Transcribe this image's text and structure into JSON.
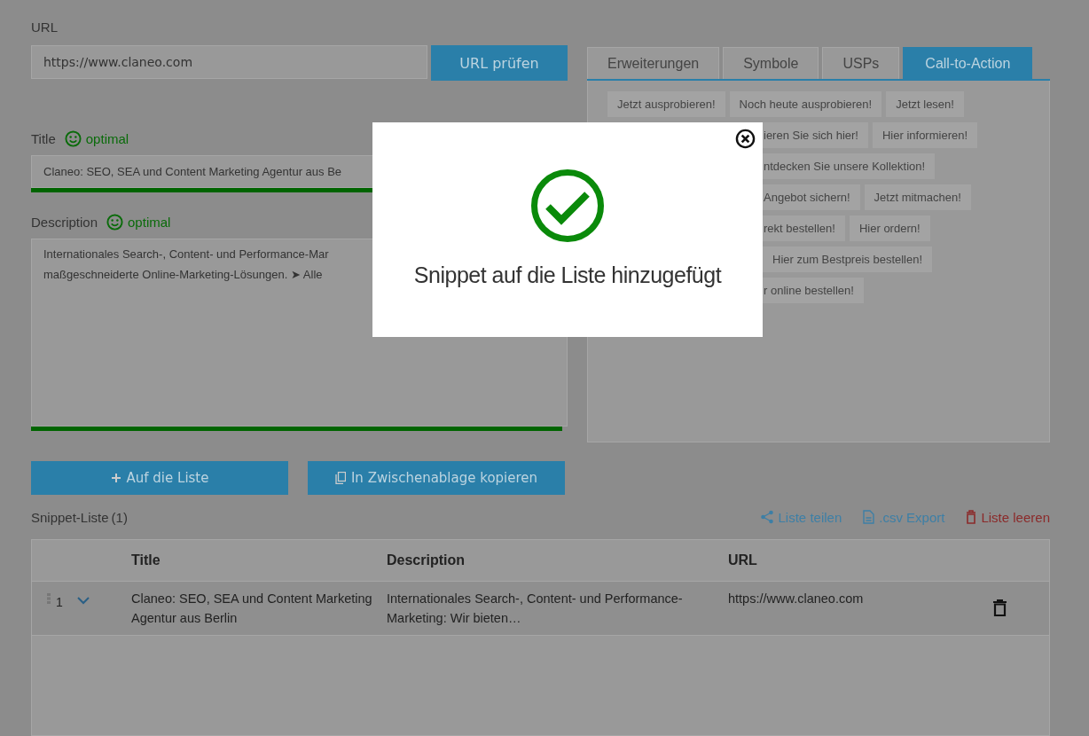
{
  "url": {
    "label": "URL",
    "value": "https://www.claneo.com",
    "button": "URL prüfen"
  },
  "fields": [
    {
      "kind": "input",
      "label": "Title",
      "status": "optimal",
      "lines": [
        "Claneo: SEO, SEA und Content Marketing Agentur aus Be"
      ],
      "level": 1
    },
    {
      "kind": "textarea",
      "label": "Description",
      "status": "optimal",
      "lines": [
        "Internationales Search-, Content- und Performance-Mar",
        "maßgeschneiderte Online-Marketing-Lösungen. ➤ Alle"
      ],
      "level": 1
    }
  ],
  "tabs": [
    {
      "label": "Erweiterungen",
      "selected": false
    },
    {
      "label": "Symbole",
      "selected": false
    },
    {
      "label": "USPs",
      "selected": false
    },
    {
      "label": "Call-to-Action",
      "selected": true
    }
  ],
  "chip_rows": [
    {
      "chips": [
        {
          "label": "Jetzt ausprobieren!",
          "cut": false
        },
        {
          "label": "Noch heute ausprobieren!",
          "cut": false
        },
        {
          "label": "Jetzt lesen!",
          "cut": false
        }
      ]
    },
    {
      "chips": [
        {
          "label": "ieren Sie sich hier!",
          "cut": true
        },
        {
          "label": "Hier informieren!",
          "cut": false
        }
      ]
    },
    {
      "chips": [
        {
          "label": "ntdecken Sie unsere Kollektion!",
          "cut": true
        }
      ]
    },
    {
      "chips": [
        {
          "label": "Angebot sichern!",
          "cut": true
        },
        {
          "label": "Jetzt mitmachen!",
          "cut": false
        }
      ]
    },
    {
      "chips": [
        {
          "label": "rekt bestellen!",
          "cut": true
        },
        {
          "label": "Hier ordern!",
          "cut": false
        }
      ]
    },
    {
      "covered": true,
      "chips": [
        {
          "label": "Hier zum Bestpreis bestellen!",
          "cut": false
        }
      ]
    },
    {
      "chips": [
        {
          "label": "r online bestellen!",
          "cut": true
        }
      ]
    }
  ],
  "actions": [
    {
      "kind": "add",
      "label": "Auf die Liste"
    },
    {
      "kind": "copy",
      "label": "In Zwischenablage kopieren"
    }
  ],
  "snippet_list": {
    "title": "Snippet-Liste",
    "count": "(1)",
    "links": [
      {
        "kind": "share",
        "label": "Liste teilen"
      },
      {
        "kind": "file",
        "label": ".csv Export"
      },
      {
        "kind": "clear",
        "label": "Liste leeren"
      }
    ],
    "columns": [
      "Title",
      "Description",
      "URL"
    ],
    "rows": [
      {
        "index": "1",
        "expanded": false,
        "title": "Claneo: SEO, SEA und Content Marketing Agentur aus Berlin",
        "description": "Internationales Search-, Content- und Performance-Marketing: Wir bieten…",
        "url": "https://www.claneo.com"
      }
    ]
  },
  "modal": {
    "message": "Snippet auf die Liste hinzugefügt"
  }
}
